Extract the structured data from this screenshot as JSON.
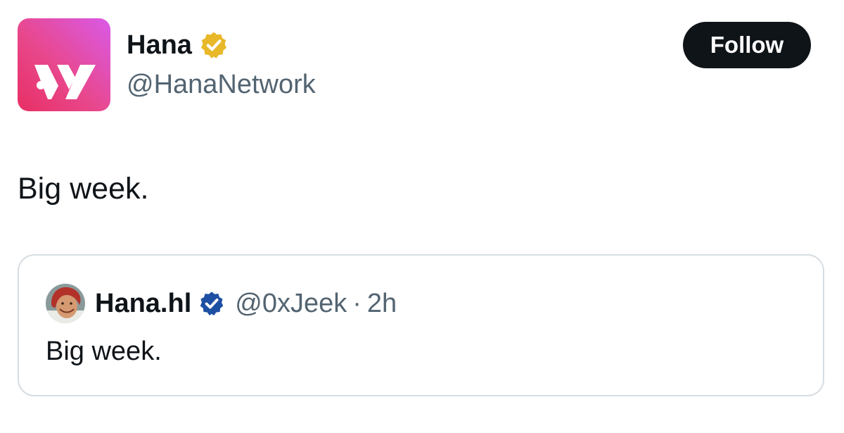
{
  "post": {
    "author": {
      "display_name": "Hana",
      "handle": "@HanaNetwork",
      "verified": "gold-checkmark-badge",
      "avatar_icon": "hana-logo-icon"
    },
    "follow_label": "Follow",
    "text": "Big week."
  },
  "quoted_post": {
    "author": {
      "display_name": "Hana.hl",
      "handle": "@0xJeek",
      "verified": "blue-checkmark-badge",
      "avatar_icon": "anime-character-avatar"
    },
    "separator": "·",
    "timestamp": "2h",
    "text": "Big week."
  },
  "colors": {
    "text_primary": "#0f1419",
    "text_secondary": "#536471",
    "follow_button_bg": "#0f1419",
    "gold_badge": "#e8b829",
    "blue_badge": "#1d4fa3",
    "card_border": "#d6dde2",
    "logo_gradient": [
      "#e82f64",
      "#d95ae8"
    ]
  }
}
